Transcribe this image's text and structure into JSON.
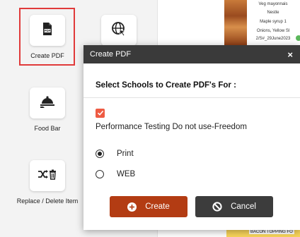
{
  "sidebar": {
    "tiles": [
      {
        "label": "Create PDF",
        "icon": "pdf-file-icon"
      },
      {
        "label": "",
        "icon": "globe-cursor-icon"
      },
      {
        "label": "Food Bar",
        "icon": "cloche-icon"
      },
      {
        "label": "Replace / Delete Item",
        "icon": "shuffle-trash-icon"
      }
    ]
  },
  "background_panel": {
    "lines": [
      "Veg mayonnais",
      "Nestle",
      "Maple syrup 1",
      "Onions, Yellow Sl",
      "2/S#_29June2023"
    ],
    "bottom_item": "BACON TOPPING FO"
  },
  "modal": {
    "title": "Create PDF",
    "close_label": "×",
    "heading": "Select Schools to Create PDF's For :",
    "school_option": {
      "label": "Performance Testing Do not use-Freedom",
      "checked": true
    },
    "format_options": [
      {
        "label": "Print",
        "selected": true
      },
      {
        "label": "WEB",
        "selected": false
      }
    ],
    "create_label": "Create",
    "cancel_label": "Cancel"
  },
  "colors": {
    "highlight": "#e03a3a",
    "create_button": "#b33c13",
    "cancel_button": "#3c3c3c",
    "checkbox": "#ee5b43",
    "modal_header": "#3a3a3a"
  }
}
